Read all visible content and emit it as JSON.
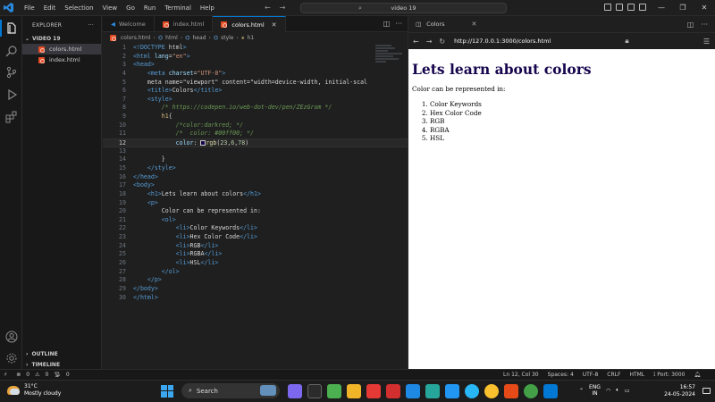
{
  "window": {
    "menu": [
      "File",
      "Edit",
      "Selection",
      "View",
      "Go",
      "Run",
      "Terminal",
      "Help"
    ],
    "command_center": "video 19"
  },
  "sidebar": {
    "title": "EXPLORER",
    "folder": "VIDEO 19",
    "files": [
      "colors.html",
      "index.html"
    ],
    "outline": "OUTLINE",
    "timeline": "TIMELINE"
  },
  "editor": {
    "tabs": [
      "Welcome",
      "index.html",
      "colors.html"
    ],
    "active_tab": "colors.html",
    "breadcrumb": [
      "colors.html",
      "html",
      "head",
      "style",
      "h1"
    ],
    "current_line": 12,
    "lines": [
      "<!DOCTYPE html>",
      "<html lang=\"en\">",
      "<head>",
      "    <meta charset=\"UTF-8\">",
      "    <meta name=\"viewport\" content=\"width=device-width, initial-scal",
      "    <title>Colors</title>",
      "    <style>",
      "        /* https://codepen.io/web-dot-dev/pen/ZEzGrom */",
      "        h1{",
      "            /*color:darkred; */",
      "            /*  color: #00ff00; */",
      "            color: rgb(23,6,78)",
      "",
      "        }",
      "    </style>",
      "</head>",
      "<body>",
      "    <h1>Lets learn about colors</h1>",
      "    <p>",
      "        Color can be represented in:",
      "        <ol>",
      "            <li>Color Keywords</li>",
      "            <li>Hex Color Code</li>",
      "            <li>RGB</li>",
      "            <li>RGBA</li>",
      "            <li>HSL</li>",
      "        </ol>",
      "    </p>",
      "</body>",
      "</html>"
    ]
  },
  "browser": {
    "tab": "Colors",
    "url": "http://127.0.0.1:3000/colors.html",
    "heading": "Lets learn about colors",
    "paragraph": "Color can be represented in:",
    "list": [
      "Color Keywords",
      "Hex Color Code",
      "RGB",
      "RGBA",
      "HSL"
    ],
    "heading_color": "#17064e"
  },
  "statusbar": {
    "errors": "0",
    "warnings": "0",
    "ports": "0",
    "position": "Ln 12, Col 30",
    "spaces": "Spaces: 4",
    "encoding": "UTF-8",
    "eol": "CRLF",
    "language": "HTML",
    "port": "Port: 3000"
  },
  "taskbar": {
    "temperature": "31°C",
    "weather": "Mostly cloudy",
    "search_placeholder": "Search",
    "lang_top": "ENG",
    "lang_bottom": "IN",
    "time": "16:57",
    "date": "24-05-2024"
  }
}
